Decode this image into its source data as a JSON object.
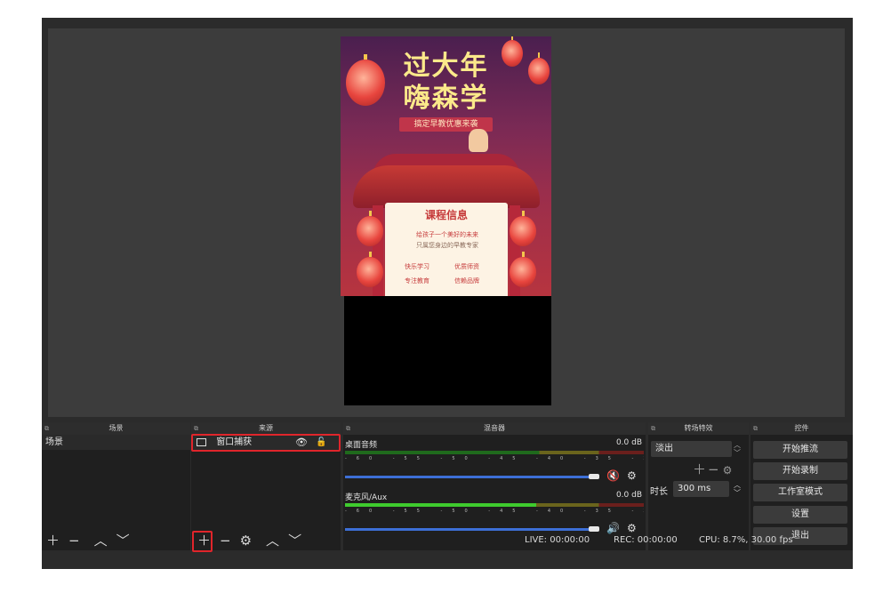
{
  "preview": {
    "poster": {
      "title_line1": "过大年",
      "title_line2": "嗨森学",
      "subtitle": "搞定早教优惠来袭",
      "card_title": "课程信息",
      "card_line1": "给孩子一个美好的未来",
      "card_line2": "只属您身边的早教专家",
      "items": [
        "快乐学习",
        "优质师资",
        "专注教育",
        "信赖品牌"
      ]
    }
  },
  "docks": {
    "scenes": {
      "title": "场景",
      "items": [
        "场景"
      ]
    },
    "sources": {
      "title": "来源",
      "items": [
        "窗口捕获"
      ]
    },
    "mixer": {
      "title": "混音器",
      "scale_text": "-60 -55 -50 -45 -40 -35 -30 -25 -20 -15 -10 -5 0",
      "channels": [
        {
          "name": "桌面音频",
          "db": "0.0 dB",
          "volume": 0.95,
          "muted": true
        },
        {
          "name": "麦克风/Aux",
          "db": "0.0 dB",
          "volume": 0.95,
          "muted": false
        }
      ]
    },
    "transitions": {
      "title": "转场特效",
      "selected": "淡出",
      "duration_label": "时长",
      "duration_value": "300 ms"
    },
    "controls": {
      "title": "控件",
      "buttons": [
        "开始推流",
        "开始录制",
        "工作室模式",
        "设置",
        "退出"
      ]
    }
  },
  "statusbar": {
    "live": "LIVE: 00:00:00",
    "rec": "REC: 00:00:00",
    "cpu": "CPU: 8.7%, 30.00 fps"
  },
  "colors": {
    "highlight": "#e0252b",
    "volume_slider": "#3d6fd6",
    "meter_green": "#3ecb2e",
    "meter_yellow": "#cbbf2e",
    "meter_red": "#cb3a2e"
  }
}
